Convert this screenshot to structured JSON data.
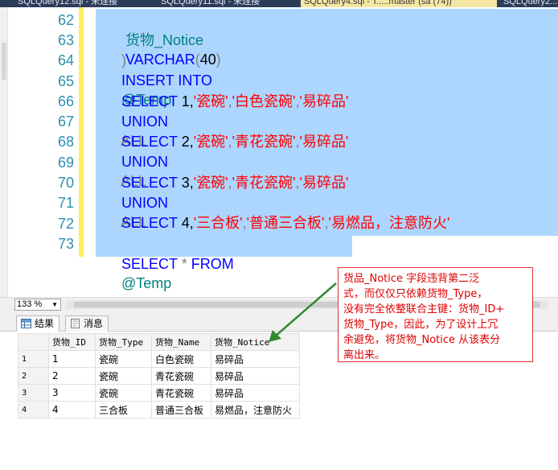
{
  "tabs": [
    {
      "label": "SQLQuery12.sql - 未连接"
    },
    {
      "label": "SQLQuery11.sql - 未连接"
    },
    {
      "label": "SQLQuery4.sql - T.....master (sa (74))"
    },
    {
      "label": "SQLQuery2..."
    }
  ],
  "editor": {
    "line_numbers": [
      "62",
      "63",
      "64",
      "65",
      "66",
      "67",
      "68",
      "69",
      "70",
      "71",
      "72",
      "73"
    ],
    "lines": {
      "l62": {
        "name": "货物_Notice",
        "type": "VARCHAR",
        "open": "(",
        "size": "40",
        "close": ")"
      },
      "l63": {
        "text": ")"
      },
      "l64": {
        "kw": "INSERT INTO",
        "var": "@Temp"
      },
      "l65": {
        "kw": "SELECT",
        "num": " 1,",
        "s1": "'瓷碗'",
        "c1": ",",
        "s2": "'白色瓷碗'",
        "c2": ",",
        "s3": "'易碎品'"
      },
      "l66": {
        "kw": "UNION",
        "gr": "ALL"
      },
      "l67": {
        "kw": "SELECT",
        "num": " 2,",
        "s1": "'瓷碗'",
        "c1": ",",
        "s2": "'青花瓷碗'",
        "c2": ",",
        "s3": "'易碎品'"
      },
      "l68": {
        "kw": "UNION",
        "gr": "ALL"
      },
      "l69": {
        "kw": "SELECT",
        "num": " 3,",
        "s1": "'瓷碗'",
        "c1": ",",
        "s2": "'青花瓷碗'",
        "c2": ",",
        "s3": "'易碎品'"
      },
      "l70": {
        "kw": "UNION",
        "gr": "ALL"
      },
      "l71": {
        "kw": "SELECT",
        "num": " 4,",
        "s1": "'三合板'",
        "c1": ",",
        "s2": "'普通三合板'",
        "c2": ",",
        "s3": "'易燃品，注意防火'"
      },
      "l73": {
        "kw1": "SELECT",
        "star": " * ",
        "kw2": "FROM",
        "var": "@Temp"
      }
    }
  },
  "zoom": {
    "value": "133 %"
  },
  "results_tabs": [
    {
      "label": "结果"
    },
    {
      "label": "消息"
    }
  ],
  "grid": {
    "columns": [
      "货物_ID",
      "货物_Type",
      "货物_Name",
      "货物_Notice"
    ],
    "rows": [
      {
        "rn": "1",
        "id": "1",
        "type": "瓷碗",
        "name": "白色瓷碗",
        "notice": "易碎品"
      },
      {
        "rn": "2",
        "id": "2",
        "type": "瓷碗",
        "name": "青花瓷碗",
        "notice": "易碎品"
      },
      {
        "rn": "3",
        "id": "3",
        "type": "瓷碗",
        "name": "青花瓷碗",
        "notice": "易碎品"
      },
      {
        "rn": "4",
        "id": "4",
        "type": "三合板",
        "name": "普通三合板",
        "notice": "易燃品，注意防火"
      }
    ]
  },
  "annotation": {
    "lines": [
      "货品_Notice 字段违背第二泛",
      "式，而仅仅只依赖货物_Type，",
      "没有完全依整联合主键：货物_ID+",
      "货物_Type，因此，为了设计上冗",
      "余避免，将货物_Notice 从该表分",
      " 离出来。"
    ]
  },
  "colors": {
    "keyword": "#0000ff",
    "string": "#ff0000",
    "selection": "#add6ff",
    "annotation": "#e00000",
    "arrow": "#2e8b2e"
  }
}
